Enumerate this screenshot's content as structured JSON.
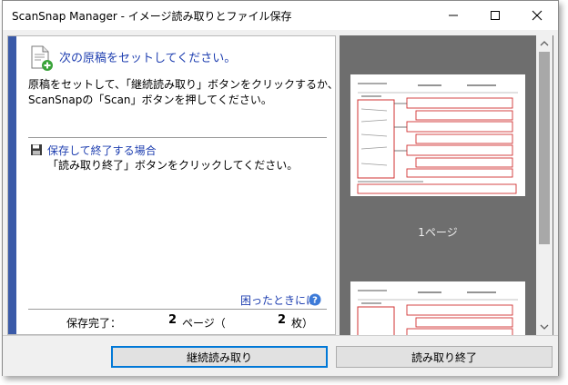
{
  "window": {
    "title": "ScanSnap Manager - イメージ読み取りとファイル保存"
  },
  "main": {
    "heading": "次の原稿をセットしてください。",
    "instruction_line1": "原稿をセットして、「継続読み取り」ボタンをクリックするか、",
    "instruction_line2": "ScanSnapの「Scan」ボタンを押してください。",
    "save_heading": "保存して終了する場合",
    "save_instruction": "「読み取り終了」ボタンをクリックしてください。",
    "help_link": "困ったときには"
  },
  "status": {
    "label": "保存完了：",
    "pages": "2",
    "pages_unit": "ページ（",
    "sheets": "2",
    "sheets_unit": "枚）"
  },
  "preview": {
    "page_label": "1ページ"
  },
  "buttons": {
    "continue_label": "継続読み取り",
    "finish_label": "読み取り終了"
  },
  "colors": {
    "accent_bar": "#3a5aa8",
    "link_blue": "#1f3fb0",
    "preview_bg": "#6e6e6e",
    "thumb_red": "#d23030"
  },
  "icons": {
    "heading": "document-add-icon",
    "save": "save-disk-icon",
    "help": "question-circle-icon"
  }
}
